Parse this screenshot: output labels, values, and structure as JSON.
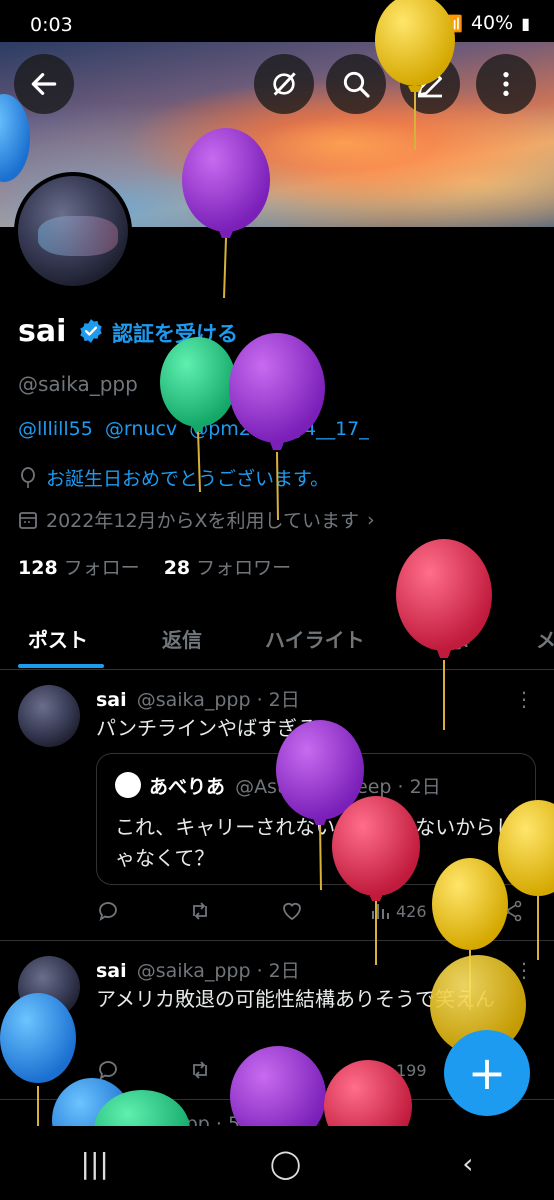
{
  "status": {
    "time": "0:03",
    "battery": "40%"
  },
  "header": {
    "back": "back-arrow-icon",
    "grok": "grok-icon",
    "search": "search-icon",
    "compose": "compose-icon",
    "more": "more-vertical-icon"
  },
  "profile": {
    "name": "sai",
    "verify_cta": "認証を受ける",
    "handle": "@saika_ppp",
    "bio_mentions": [
      "@lllill55",
      "@rnucv",
      "@pm26z",
      "@4__17_"
    ],
    "birthday": "お誕生日おめでとうございます。",
    "joined": "2022年12月からXを利用しています",
    "following_count": "128",
    "following_label": "フォロー",
    "followers_count": "28",
    "followers_label": "フォロワー"
  },
  "tabs": [
    "ポスト",
    "返信",
    "ハイライト",
    "記事",
    "メ"
  ],
  "posts": [
    {
      "name": "sai",
      "handle": "@saika_ppp",
      "time": "2日",
      "text": "パンチラインやばすぎる",
      "quote": {
        "name": "あべりあ",
        "handle": "@Astray__sheep",
        "time": "2日",
        "text": "これ、キャリーされないとおもんないからじゃなくて？"
      },
      "views": "426"
    },
    {
      "name": "sai",
      "handle": "@saika_ppp",
      "time": "2日",
      "text": "アメリカ敗退の可能性結構ありそうで笑えん",
      "views": "199"
    },
    {
      "handle": "@saika_ppp",
      "time": "5日"
    }
  ],
  "fab": "+",
  "navbar": {
    "recents": "|||",
    "home": "◯",
    "back": "‹"
  },
  "colors": {
    "accent": "#1d9bf0",
    "bg": "#000000",
    "muted": "#71767b"
  }
}
